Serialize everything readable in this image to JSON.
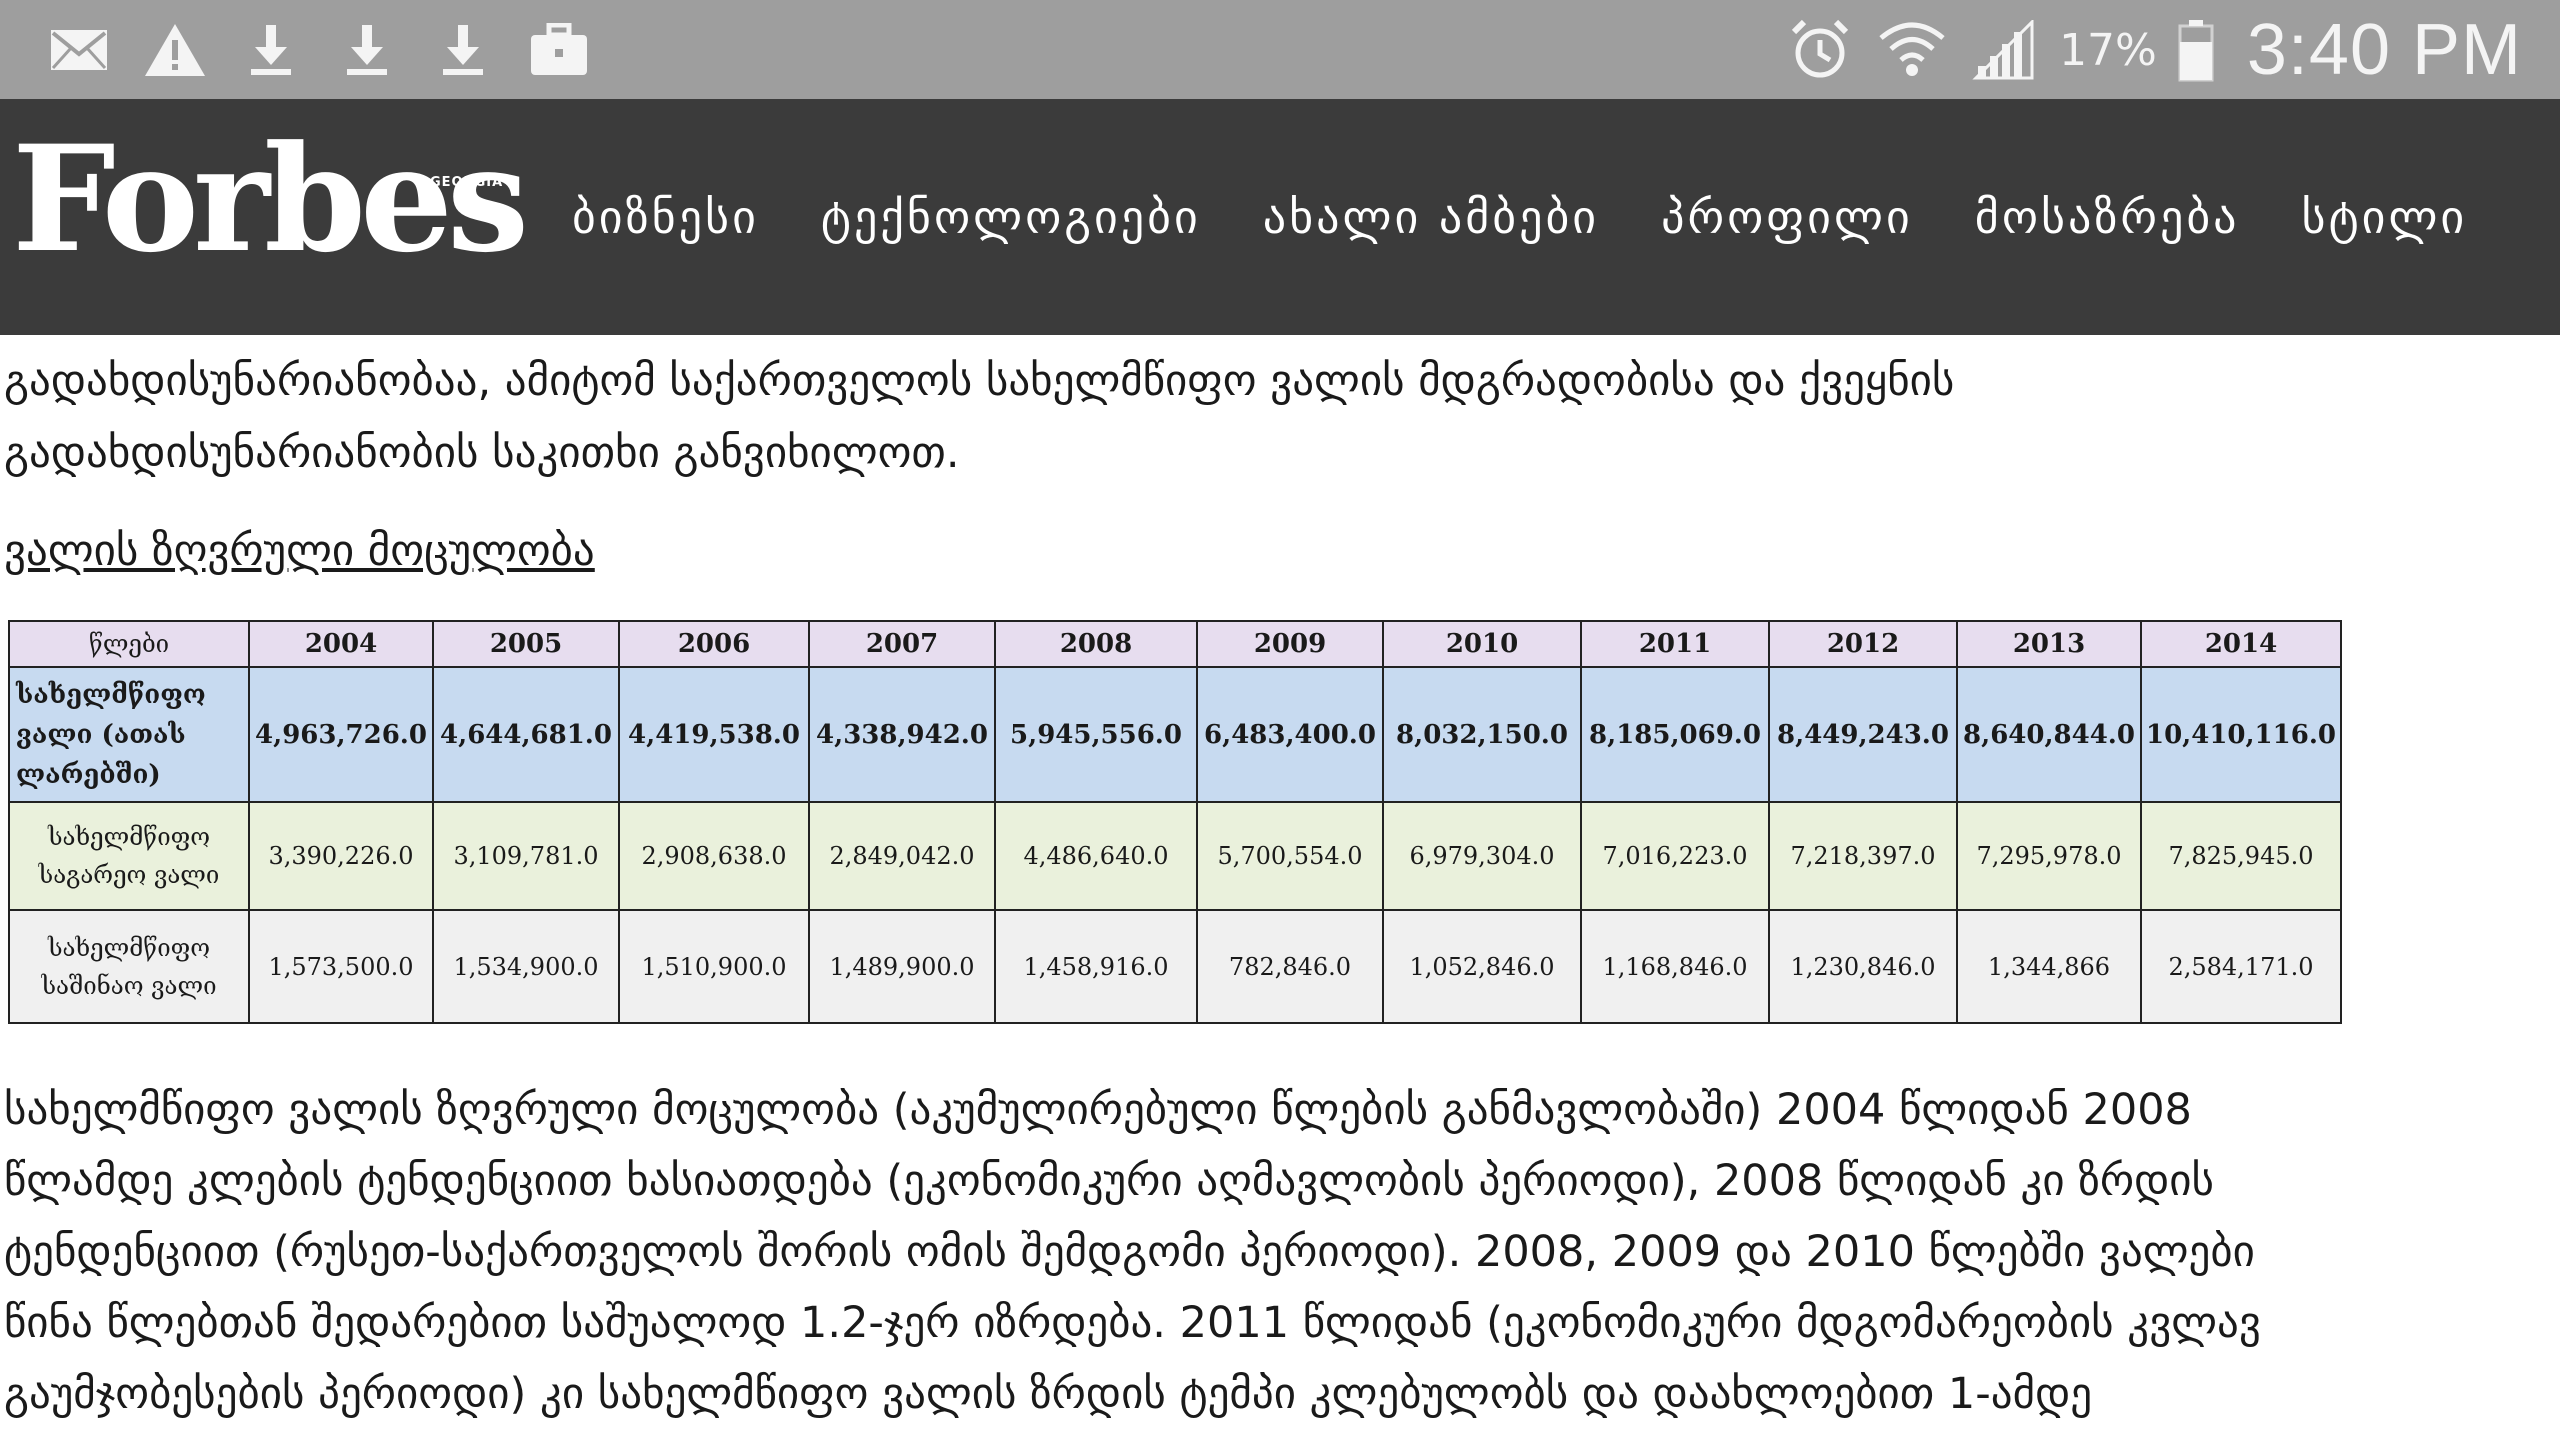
{
  "status_bar": {
    "left_icons": [
      "mail-icon",
      "warning-icon",
      "download-icon",
      "download-icon",
      "download-icon",
      "briefcase-icon"
    ],
    "right_icons": [
      "alarm-icon",
      "wifi-icon",
      "signal-icon"
    ],
    "battery_percent": "17%",
    "time": "3:40 PM"
  },
  "header": {
    "logo_text": "Forbes",
    "logo_sub": "GEORGIA",
    "nav_items": [
      "ბიზნესი",
      "ტექნოლოგიები",
      "ახალი ამბები",
      "პროფილი",
      "მოსაზრება",
      "სტილი"
    ]
  },
  "article": {
    "top_lines": [
      "გადახდისუნარიანობაა, ამიტომ საქართველოს სახელმწიფო ვალის მდგრადობისა და ქვეყნის",
      "გადახდისუნარიანობის საკითხი განვიხილოთ."
    ],
    "section_heading": "ვალის ზღვრული მოცულობა",
    "table": {
      "header_label": "წლები",
      "years": [
        "2004",
        "2005",
        "2006",
        "2007",
        "2008",
        "2009",
        "2010",
        "2011",
        "2012",
        "2013",
        "2014"
      ],
      "rows": [
        {
          "label": "სახელმწიფო ვალი (ათას ლარებში)",
          "values": [
            "4,963,726.0",
            "4,644,681.0",
            "4,419,538.0",
            "4,338,942.0",
            "5,945,556.0",
            "6,483,400.0",
            "8,032,150.0",
            "8,185,069.0",
            "8,449,243.0",
            "8,640,844.0",
            "10,410,116.0"
          ]
        },
        {
          "label": "სახელმწიფო საგარეო ვალი",
          "values": [
            "3,390,226.0",
            "3,109,781.0",
            "2,908,638.0",
            "2,849,042.0",
            "4,486,640.0",
            "5,700,554.0",
            "6,979,304.0",
            "7,016,223.0",
            "7,218,397.0",
            "7,295,978.0",
            "7,825,945.0"
          ]
        },
        {
          "label": "სახელმწიფო საშინაო ვალი",
          "values": [
            "1,573,500.0",
            "1,534,900.0",
            "1,510,900.0",
            "1,489,900.0",
            "1,458,916.0",
            "782,846.0",
            "1,052,846.0",
            "1,168,846.0",
            "1,230,846.0",
            "1,344,866",
            "2,584,171.0"
          ]
        }
      ]
    },
    "bottom_lines": [
      "სახელმწიფო ვალის ზღვრული მოცულობა (აკუმულირებული წლების განმავლობაში) 2004 წლიდან 2008",
      "წლამდე კლების ტენდენციით ხასიათდება (ეკონომიკური აღმავლობის პერიოდი), 2008 წლიდან კი ზრდის",
      "ტენდენციით (რუსეთ-საქართველოს შორის ომის შემდგომი პერიოდი). 2008, 2009 და 2010 წლებში ვალები",
      "წინა წლებთან შედარებით საშუალოდ 1.2-ჯერ იზრდება. 2011 წლიდან (ეკონომიკური მდგომარეობის კვლავ",
      "გაუმჯობესების პერიოდი) კი სახელმწიფო ვალის ზრდის ტემპი კლებულობს და დაახლოებით 1-ამდე"
    ]
  }
}
